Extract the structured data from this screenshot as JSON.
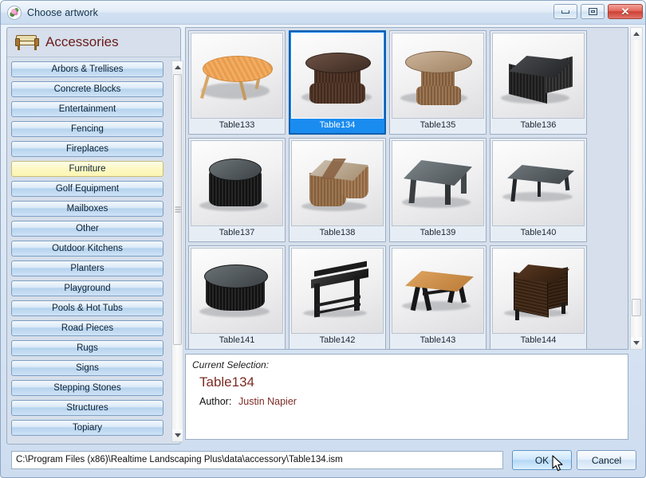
{
  "window": {
    "title": "Choose artwork",
    "icon": "flower-icon",
    "controls": {
      "minimize": "minimize-icon",
      "restore": "restore-icon",
      "close": "close-icon"
    }
  },
  "sidebar": {
    "header": {
      "title": "Accessories",
      "icon": "sofa-icon"
    },
    "selected": "Furniture",
    "items": [
      {
        "label": "Arbors & Trellises"
      },
      {
        "label": "Concrete Blocks"
      },
      {
        "label": "Entertainment"
      },
      {
        "label": "Fencing"
      },
      {
        "label": "Fireplaces"
      },
      {
        "label": "Furniture"
      },
      {
        "label": "Golf Equipment"
      },
      {
        "label": "Mailboxes"
      },
      {
        "label": "Other"
      },
      {
        "label": "Outdoor Kitchens"
      },
      {
        "label": "Planters"
      },
      {
        "label": "Playground"
      },
      {
        "label": "Pools & Hot Tubs"
      },
      {
        "label": "Road Pieces"
      },
      {
        "label": "Rugs"
      },
      {
        "label": "Signs"
      },
      {
        "label": "Stepping Stones"
      },
      {
        "label": "Structures"
      },
      {
        "label": "Topiary"
      }
    ]
  },
  "grid": {
    "selected": "Table134",
    "items": [
      {
        "label": "Table133",
        "art": "round-wood-table"
      },
      {
        "label": "Table134",
        "art": "dark-wicker-drum-table"
      },
      {
        "label": "Table135",
        "art": "tan-wicker-drum-table"
      },
      {
        "label": "Table136",
        "art": "black-rect-box-table"
      },
      {
        "label": "Table137",
        "art": "black-oval-ottoman"
      },
      {
        "label": "Table138",
        "art": "tan-wicker-cube-ottoman"
      },
      {
        "label": "Table139",
        "art": "grey-stone-coffee-table"
      },
      {
        "label": "Table140",
        "art": "grey-long-bench-table"
      },
      {
        "label": "Table141",
        "art": "black-round-drum-table"
      },
      {
        "label": "Table142",
        "art": "black-console-bar-table"
      },
      {
        "label": "Table143",
        "art": "wood-top-trestle-table"
      },
      {
        "label": "Table144",
        "art": "dark-wood-cabinet"
      }
    ]
  },
  "info": {
    "current_selection_label": "Current Selection:",
    "name": "Table134",
    "author_label": "Author:",
    "author_value": "Justin Napier"
  },
  "footer": {
    "path": "C:\\Program Files (x86)\\Realtime Landscaping Plus\\data\\accessory\\Table134.ism",
    "ok_label": "OK",
    "cancel_label": "Cancel"
  },
  "colors": {
    "selection_blue": "#1a8cf0",
    "accent_dark_red": "#7d2b24",
    "highlight_yellow": "#fdf8c2"
  }
}
